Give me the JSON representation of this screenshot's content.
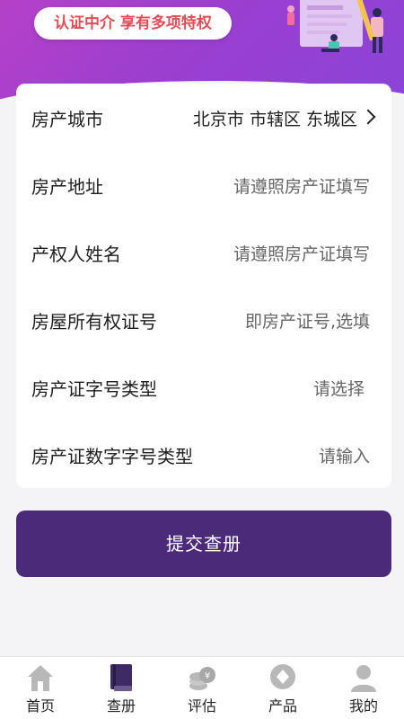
{
  "banner": {
    "badge_text": "认证中介  享有多项特权"
  },
  "form": {
    "rows": [
      {
        "label": "房产城市",
        "value": "北京市 市辖区 东城区"
      },
      {
        "label": "房产地址",
        "placeholder": "请遵照房产证填写"
      },
      {
        "label": "产权人姓名",
        "placeholder": "请遵照房产证填写"
      },
      {
        "label": "房屋所有权证号",
        "placeholder": "即房产证号,选填"
      },
      {
        "label": "房产证字号类型",
        "placeholder": "请选择"
      },
      {
        "label": "房产证数字字号类型",
        "placeholder": "请输入"
      }
    ]
  },
  "submit_label": "提交查册",
  "tabbar": {
    "active_color": "#4b2a7a",
    "items": [
      {
        "label": "首页",
        "icon": "home-icon"
      },
      {
        "label": "查册",
        "icon": "book-icon"
      },
      {
        "label": "评估",
        "icon": "coins-icon"
      },
      {
        "label": "产品",
        "icon": "diamond-icon"
      },
      {
        "label": "我的",
        "icon": "user-icon"
      }
    ]
  },
  "colors": {
    "header_start": "#b640c8",
    "header_end": "#8a44d8",
    "badge_text": "#e04d56",
    "button_bg": "#4b2a7a"
  }
}
